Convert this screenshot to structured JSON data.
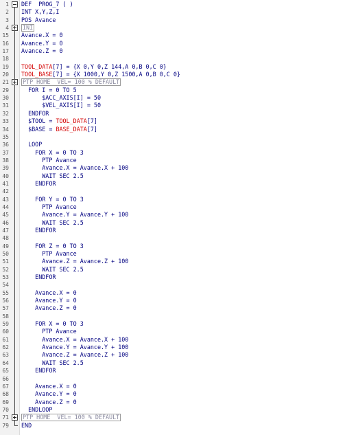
{
  "editor": {
    "lines": [
      {
        "num": "1",
        "fold": "open-start",
        "indent": 0,
        "segments": [
          {
            "t": "DEF  PROG_7 ( )",
            "c": "dark"
          }
        ]
      },
      {
        "num": "2",
        "fold": "line",
        "indent": 0,
        "segments": [
          {
            "t": "INT X,Y,Z,I",
            "c": "dark"
          }
        ]
      },
      {
        "num": "3",
        "fold": "line",
        "indent": 0,
        "segments": [
          {
            "t": "POS Avance",
            "c": "dark"
          }
        ]
      },
      {
        "num": "4",
        "fold": "closed",
        "indent": 0,
        "segments": [
          {
            "t": "INI",
            "c": "box"
          }
        ]
      },
      {
        "num": "15",
        "fold": "line",
        "indent": 0,
        "segments": [
          {
            "t": "Avance.X = 0",
            "c": "dark"
          }
        ]
      },
      {
        "num": "16",
        "fold": "line",
        "indent": 0,
        "segments": [
          {
            "t": "Avance.Y = 0",
            "c": "dark"
          }
        ]
      },
      {
        "num": "17",
        "fold": "line",
        "indent": 0,
        "segments": [
          {
            "t": "Avance.Z = 0",
            "c": "dark"
          }
        ]
      },
      {
        "num": "18",
        "fold": "line",
        "indent": 0,
        "segments": []
      },
      {
        "num": "19",
        "fold": "line",
        "indent": 0,
        "segments": [
          {
            "t": "TOOL_DATA",
            "c": "red"
          },
          {
            "t": "[7] = {X 0,Y 0,Z 144,A 0,B 0,C 0}",
            "c": "dark"
          }
        ]
      },
      {
        "num": "20",
        "fold": "line",
        "indent": 0,
        "segments": [
          {
            "t": "TOOL_BASE",
            "c": "red"
          },
          {
            "t": "[7] = {X 1000,Y 0,Z 1500,A 0,B 0,C 0}",
            "c": "dark"
          }
        ]
      },
      {
        "num": "21",
        "fold": "closed",
        "indent": 0,
        "segments": [
          {
            "t": "PTP HOME  VEL= 100 % DEFAULT",
            "c": "box"
          }
        ]
      },
      {
        "num": "29",
        "fold": "line",
        "indent": 2,
        "segments": [
          {
            "t": "FOR I = 0 TO 5",
            "c": "dark"
          }
        ]
      },
      {
        "num": "30",
        "fold": "line",
        "indent": 6,
        "segments": [
          {
            "t": "$ACC_AXIS[I] = 50",
            "c": "dark"
          }
        ]
      },
      {
        "num": "31",
        "fold": "line",
        "indent": 6,
        "segments": [
          {
            "t": "$VEL_AXIS[I] = 50",
            "c": "dark"
          }
        ]
      },
      {
        "num": "32",
        "fold": "line",
        "indent": 2,
        "segments": [
          {
            "t": "ENDFOR",
            "c": "dark"
          }
        ]
      },
      {
        "num": "33",
        "fold": "line",
        "indent": 2,
        "segments": [
          {
            "t": "$TOOL = ",
            "c": "dark"
          },
          {
            "t": "TOOL_DATA",
            "c": "red"
          },
          {
            "t": "[7]",
            "c": "dark"
          }
        ]
      },
      {
        "num": "34",
        "fold": "line",
        "indent": 2,
        "segments": [
          {
            "t": "$BASE = ",
            "c": "dark"
          },
          {
            "t": "BASE_DATA",
            "c": "red"
          },
          {
            "t": "[7]",
            "c": "dark"
          }
        ]
      },
      {
        "num": "35",
        "fold": "line",
        "indent": 0,
        "segments": []
      },
      {
        "num": "36",
        "fold": "line",
        "indent": 2,
        "segments": [
          {
            "t": "LOOP",
            "c": "dark"
          }
        ]
      },
      {
        "num": "37",
        "fold": "line",
        "indent": 4,
        "segments": [
          {
            "t": "FOR X = 0 TO 3",
            "c": "dark"
          }
        ]
      },
      {
        "num": "38",
        "fold": "line",
        "indent": 6,
        "segments": [
          {
            "t": "PTP Avance",
            "c": "dark"
          }
        ]
      },
      {
        "num": "39",
        "fold": "line",
        "indent": 6,
        "segments": [
          {
            "t": "Avance.X = Avance.X + 100",
            "c": "dark"
          }
        ]
      },
      {
        "num": "40",
        "fold": "line",
        "indent": 6,
        "segments": [
          {
            "t": "WAIT SEC 2.5",
            "c": "dark"
          }
        ]
      },
      {
        "num": "41",
        "fold": "line",
        "indent": 4,
        "segments": [
          {
            "t": "ENDFOR",
            "c": "dark"
          }
        ]
      },
      {
        "num": "42",
        "fold": "line",
        "indent": 0,
        "segments": []
      },
      {
        "num": "43",
        "fold": "line",
        "indent": 4,
        "segments": [
          {
            "t": "FOR Y = 0 TO 3",
            "c": "dark"
          }
        ]
      },
      {
        "num": "44",
        "fold": "line",
        "indent": 6,
        "segments": [
          {
            "t": "PTP Avance",
            "c": "dark"
          }
        ]
      },
      {
        "num": "45",
        "fold": "line",
        "indent": 6,
        "segments": [
          {
            "t": "Avance.Y = Avance.Y + 100",
            "c": "dark"
          }
        ]
      },
      {
        "num": "46",
        "fold": "line",
        "indent": 6,
        "segments": [
          {
            "t": "WAIT SEC 2.5",
            "c": "dark"
          }
        ]
      },
      {
        "num": "47",
        "fold": "line",
        "indent": 4,
        "segments": [
          {
            "t": "ENDFOR",
            "c": "dark"
          }
        ]
      },
      {
        "num": "48",
        "fold": "line",
        "indent": 0,
        "segments": []
      },
      {
        "num": "49",
        "fold": "line",
        "indent": 4,
        "segments": [
          {
            "t": "FOR Z = 0 TO 3",
            "c": "dark"
          }
        ]
      },
      {
        "num": "50",
        "fold": "line",
        "indent": 6,
        "segments": [
          {
            "t": "PTP Avance",
            "c": "dark"
          }
        ]
      },
      {
        "num": "51",
        "fold": "line",
        "indent": 6,
        "segments": [
          {
            "t": "Avance.Z = Avance.Z + 100",
            "c": "dark"
          }
        ]
      },
      {
        "num": "52",
        "fold": "line",
        "indent": 6,
        "segments": [
          {
            "t": "WAIT SEC 2.5",
            "c": "dark"
          }
        ]
      },
      {
        "num": "53",
        "fold": "line",
        "indent": 4,
        "segments": [
          {
            "t": "ENDFOR",
            "c": "dark"
          }
        ]
      },
      {
        "num": "54",
        "fold": "line",
        "indent": 0,
        "segments": []
      },
      {
        "num": "55",
        "fold": "line",
        "indent": 4,
        "segments": [
          {
            "t": "Avance.X = 0",
            "c": "dark"
          }
        ]
      },
      {
        "num": "56",
        "fold": "line",
        "indent": 4,
        "segments": [
          {
            "t": "Avance.Y = 0",
            "c": "dark"
          }
        ]
      },
      {
        "num": "57",
        "fold": "line",
        "indent": 4,
        "segments": [
          {
            "t": "Avance.Z = 0",
            "c": "dark"
          }
        ]
      },
      {
        "num": "58",
        "fold": "line",
        "indent": 0,
        "segments": []
      },
      {
        "num": "59",
        "fold": "line",
        "indent": 4,
        "segments": [
          {
            "t": "FOR X = 0 TO 3",
            "c": "dark"
          }
        ]
      },
      {
        "num": "60",
        "fold": "line",
        "indent": 6,
        "segments": [
          {
            "t": "PTP Avance",
            "c": "dark"
          }
        ]
      },
      {
        "num": "61",
        "fold": "line",
        "indent": 6,
        "segments": [
          {
            "t": "Avance.X = Avance.X + 100",
            "c": "dark"
          }
        ]
      },
      {
        "num": "62",
        "fold": "line",
        "indent": 6,
        "segments": [
          {
            "t": "Avance.Y = Avance.Y + 100",
            "c": "dark"
          }
        ]
      },
      {
        "num": "63",
        "fold": "line",
        "indent": 6,
        "segments": [
          {
            "t": "Avance.Z = Avance.Z + 100",
            "c": "dark"
          }
        ]
      },
      {
        "num": "64",
        "fold": "line",
        "indent": 6,
        "segments": [
          {
            "t": "WAIT SEC 2.5",
            "c": "dark"
          }
        ]
      },
      {
        "num": "65",
        "fold": "line",
        "indent": 4,
        "segments": [
          {
            "t": "ENDFOR",
            "c": "dark"
          }
        ]
      },
      {
        "num": "66",
        "fold": "line",
        "indent": 0,
        "segments": []
      },
      {
        "num": "67",
        "fold": "line",
        "indent": 4,
        "segments": [
          {
            "t": "Avance.X = 0",
            "c": "dark"
          }
        ]
      },
      {
        "num": "68",
        "fold": "line",
        "indent": 4,
        "segments": [
          {
            "t": "Avance.Y = 0",
            "c": "dark"
          }
        ]
      },
      {
        "num": "69",
        "fold": "line",
        "indent": 4,
        "segments": [
          {
            "t": "Avance.Z = 0",
            "c": "dark"
          }
        ]
      },
      {
        "num": "70",
        "fold": "line",
        "indent": 2,
        "segments": [
          {
            "t": "ENDLOOP",
            "c": "dark"
          }
        ]
      },
      {
        "num": "71",
        "fold": "closed",
        "indent": 0,
        "segments": [
          {
            "t": "PTP HOME  VEL= 100 % DEFAULT",
            "c": "box"
          }
        ]
      },
      {
        "num": "79",
        "fold": "end",
        "indent": 0,
        "segments": [
          {
            "t": "END",
            "c": "dark"
          }
        ]
      }
    ]
  },
  "colors": {
    "keyword": "#000080",
    "highlight": "#d40000",
    "folded": "#8a8aa0",
    "background": "#ffffff",
    "gutter": "#f2f2f2"
  }
}
